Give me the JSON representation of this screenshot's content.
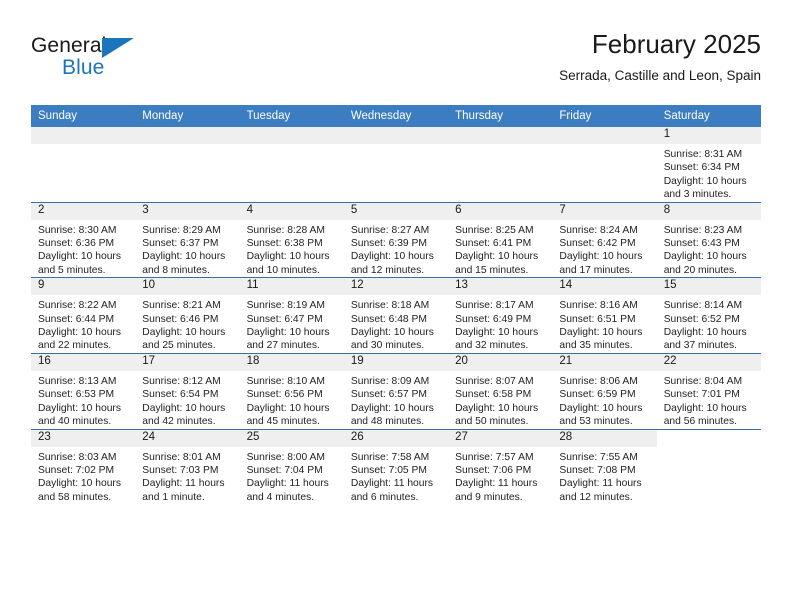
{
  "brand": {
    "name_top": "General",
    "name_bottom": "Blue",
    "accent_color": "#1b75bb"
  },
  "header": {
    "title": "February 2025",
    "subtitle": "Serrada, Castille and Leon, Spain"
  },
  "calendar": {
    "header_bg": "#3b7dc0",
    "daynum_band_bg": "#efefef",
    "grid_line_color": "#2f6fb2",
    "weekday_headers": [
      "Sunday",
      "Monday",
      "Tuesday",
      "Wednesday",
      "Thursday",
      "Friday",
      "Saturday"
    ],
    "labels": {
      "sunrise": "Sunrise:",
      "sunset": "Sunset:",
      "daylight": "Daylight:"
    },
    "weeks": [
      [
        {
          "day": "",
          "empty": true
        },
        {
          "day": "",
          "empty": true
        },
        {
          "day": "",
          "empty": true
        },
        {
          "day": "",
          "empty": true
        },
        {
          "day": "",
          "empty": true
        },
        {
          "day": "",
          "empty": true
        },
        {
          "day": "1",
          "sunrise": "Sunrise: 8:31 AM",
          "sunset": "Sunset: 6:34 PM",
          "daylight": "Daylight: 10 hours and 3 minutes."
        }
      ],
      [
        {
          "day": "2",
          "sunrise": "Sunrise: 8:30 AM",
          "sunset": "Sunset: 6:36 PM",
          "daylight": "Daylight: 10 hours and 5 minutes."
        },
        {
          "day": "3",
          "sunrise": "Sunrise: 8:29 AM",
          "sunset": "Sunset: 6:37 PM",
          "daylight": "Daylight: 10 hours and 8 minutes."
        },
        {
          "day": "4",
          "sunrise": "Sunrise: 8:28 AM",
          "sunset": "Sunset: 6:38 PM",
          "daylight": "Daylight: 10 hours and 10 minutes."
        },
        {
          "day": "5",
          "sunrise": "Sunrise: 8:27 AM",
          "sunset": "Sunset: 6:39 PM",
          "daylight": "Daylight: 10 hours and 12 minutes."
        },
        {
          "day": "6",
          "sunrise": "Sunrise: 8:25 AM",
          "sunset": "Sunset: 6:41 PM",
          "daylight": "Daylight: 10 hours and 15 minutes."
        },
        {
          "day": "7",
          "sunrise": "Sunrise: 8:24 AM",
          "sunset": "Sunset: 6:42 PM",
          "daylight": "Daylight: 10 hours and 17 minutes."
        },
        {
          "day": "8",
          "sunrise": "Sunrise: 8:23 AM",
          "sunset": "Sunset: 6:43 PM",
          "daylight": "Daylight: 10 hours and 20 minutes."
        }
      ],
      [
        {
          "day": "9",
          "sunrise": "Sunrise: 8:22 AM",
          "sunset": "Sunset: 6:44 PM",
          "daylight": "Daylight: 10 hours and 22 minutes."
        },
        {
          "day": "10",
          "sunrise": "Sunrise: 8:21 AM",
          "sunset": "Sunset: 6:46 PM",
          "daylight": "Daylight: 10 hours and 25 minutes."
        },
        {
          "day": "11",
          "sunrise": "Sunrise: 8:19 AM",
          "sunset": "Sunset: 6:47 PM",
          "daylight": "Daylight: 10 hours and 27 minutes."
        },
        {
          "day": "12",
          "sunrise": "Sunrise: 8:18 AM",
          "sunset": "Sunset: 6:48 PM",
          "daylight": "Daylight: 10 hours and 30 minutes."
        },
        {
          "day": "13",
          "sunrise": "Sunrise: 8:17 AM",
          "sunset": "Sunset: 6:49 PM",
          "daylight": "Daylight: 10 hours and 32 minutes."
        },
        {
          "day": "14",
          "sunrise": "Sunrise: 8:16 AM",
          "sunset": "Sunset: 6:51 PM",
          "daylight": "Daylight: 10 hours and 35 minutes."
        },
        {
          "day": "15",
          "sunrise": "Sunrise: 8:14 AM",
          "sunset": "Sunset: 6:52 PM",
          "daylight": "Daylight: 10 hours and 37 minutes."
        }
      ],
      [
        {
          "day": "16",
          "sunrise": "Sunrise: 8:13 AM",
          "sunset": "Sunset: 6:53 PM",
          "daylight": "Daylight: 10 hours and 40 minutes."
        },
        {
          "day": "17",
          "sunrise": "Sunrise: 8:12 AM",
          "sunset": "Sunset: 6:54 PM",
          "daylight": "Daylight: 10 hours and 42 minutes."
        },
        {
          "day": "18",
          "sunrise": "Sunrise: 8:10 AM",
          "sunset": "Sunset: 6:56 PM",
          "daylight": "Daylight: 10 hours and 45 minutes."
        },
        {
          "day": "19",
          "sunrise": "Sunrise: 8:09 AM",
          "sunset": "Sunset: 6:57 PM",
          "daylight": "Daylight: 10 hours and 48 minutes."
        },
        {
          "day": "20",
          "sunrise": "Sunrise: 8:07 AM",
          "sunset": "Sunset: 6:58 PM",
          "daylight": "Daylight: 10 hours and 50 minutes."
        },
        {
          "day": "21",
          "sunrise": "Sunrise: 8:06 AM",
          "sunset": "Sunset: 6:59 PM",
          "daylight": "Daylight: 10 hours and 53 minutes."
        },
        {
          "day": "22",
          "sunrise": "Sunrise: 8:04 AM",
          "sunset": "Sunset: 7:01 PM",
          "daylight": "Daylight: 10 hours and 56 minutes."
        }
      ],
      [
        {
          "day": "23",
          "sunrise": "Sunrise: 8:03 AM",
          "sunset": "Sunset: 7:02 PM",
          "daylight": "Daylight: 10 hours and 58 minutes."
        },
        {
          "day": "24",
          "sunrise": "Sunrise: 8:01 AM",
          "sunset": "Sunset: 7:03 PM",
          "daylight": "Daylight: 11 hours and 1 minute."
        },
        {
          "day": "25",
          "sunrise": "Sunrise: 8:00 AM",
          "sunset": "Sunset: 7:04 PM",
          "daylight": "Daylight: 11 hours and 4 minutes."
        },
        {
          "day": "26",
          "sunrise": "Sunrise: 7:58 AM",
          "sunset": "Sunset: 7:05 PM",
          "daylight": "Daylight: 11 hours and 6 minutes."
        },
        {
          "day": "27",
          "sunrise": "Sunrise: 7:57 AM",
          "sunset": "Sunset: 7:06 PM",
          "daylight": "Daylight: 11 hours and 9 minutes."
        },
        {
          "day": "28",
          "sunrise": "Sunrise: 7:55 AM",
          "sunset": "Sunset: 7:08 PM",
          "daylight": "Daylight: 11 hours and 12 minutes."
        },
        {
          "day": "",
          "empty": true,
          "trailing": true
        }
      ]
    ]
  }
}
